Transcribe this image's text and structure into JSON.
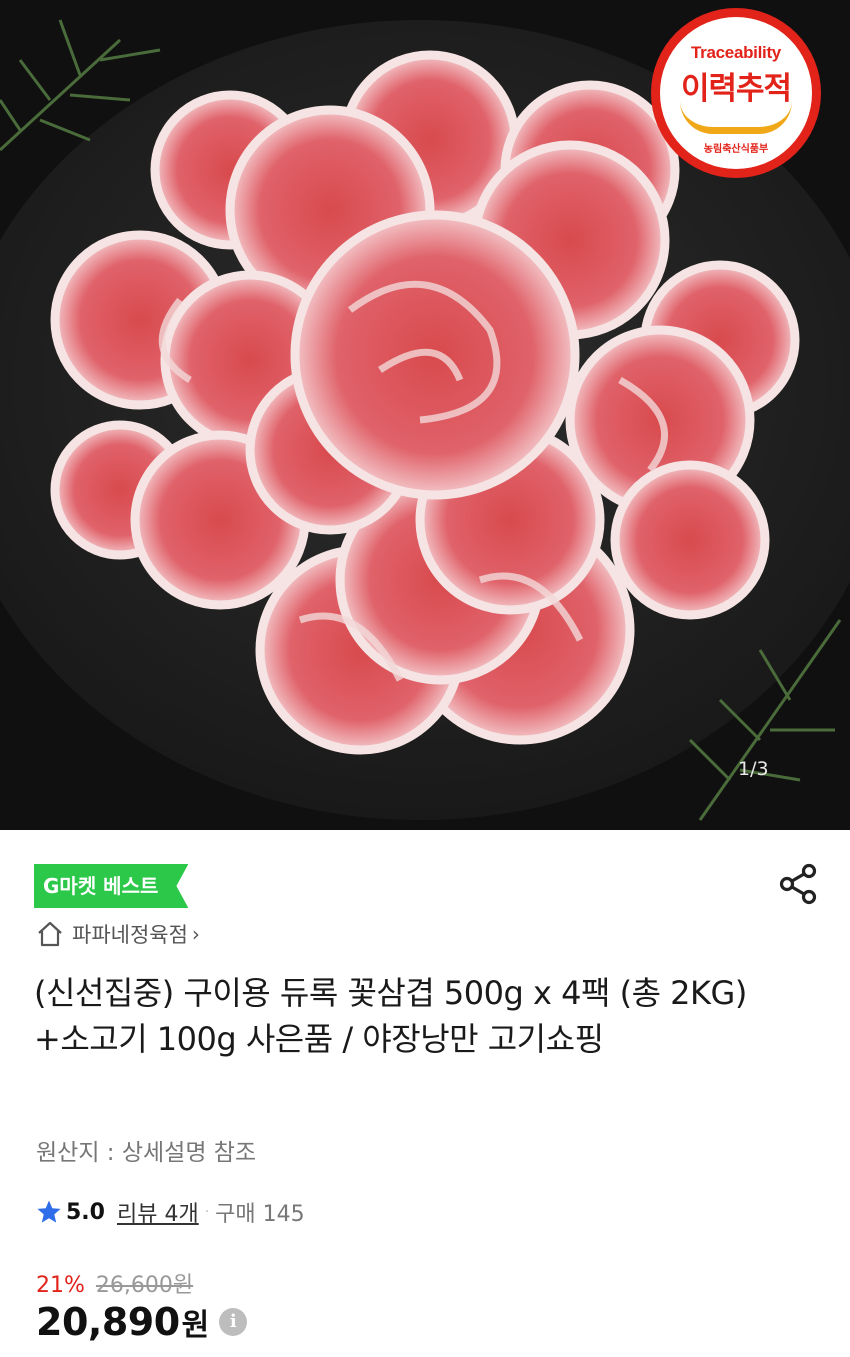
{
  "hero": {
    "badge_en": "Traceability",
    "badge_ko": "이력추적",
    "badge_ministry": "농림축산식품부",
    "image_counter": "1/3"
  },
  "product": {
    "badge_label": "G마켓 베스트",
    "store_name": "파파네정육점",
    "title": "(신선집중) 구이용 듀록 꽃삼겹 500g x 4팩 (총 2KG) +소고기 100g 사은품 / 야장낭만 고기쇼핑",
    "origin": "원산지 : 상세설명 참조",
    "rating_score": "5.0",
    "review_link": "리뷰 4개",
    "separator": "·",
    "purchase_count": "구매 145",
    "discount_percent": "21%",
    "original_price": "26,600원",
    "price": "20,890",
    "price_unit": "원"
  },
  "colors": {
    "accent_red": "#e2231a",
    "best_green": "#2cc84a",
    "star_blue": "#2f6ee8"
  },
  "icons": [
    "share-icon",
    "home-icon",
    "chevron-right-icon",
    "star-icon",
    "info-icon"
  ]
}
